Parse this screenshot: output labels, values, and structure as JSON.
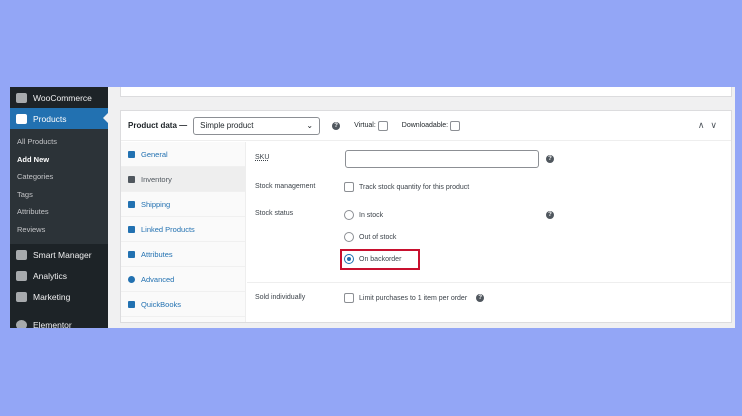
{
  "sidebar": {
    "woocommerce": "WooCommerce",
    "products": "Products",
    "submenu": [
      "All Products",
      "Add New",
      "Categories",
      "Tags",
      "Attributes",
      "Reviews"
    ],
    "more": [
      "Smart Manager",
      "Analytics",
      "Marketing",
      "Elementor"
    ]
  },
  "product_data": {
    "title": "Product data —",
    "type": "Simple product",
    "virtual": "Virtual:",
    "downloadable": "Downloadable:",
    "tabs": [
      "General",
      "Inventory",
      "Shipping",
      "Linked Products",
      "Attributes",
      "Advanced",
      "QuickBooks"
    ],
    "fields": {
      "sku": "SKU",
      "stock_management": "Stock management",
      "track_stock": "Track stock quantity for this product",
      "stock_status": "Stock status",
      "options": [
        "In stock",
        "Out of stock",
        "On backorder"
      ],
      "selected": "On backorder",
      "sold_individually": "Sold individually",
      "limit": "Limit purchases to 1 item per order"
    }
  },
  "colors": {
    "accent": "#2271b1",
    "highlight": "#c8102e",
    "background": "#93a6f6"
  }
}
